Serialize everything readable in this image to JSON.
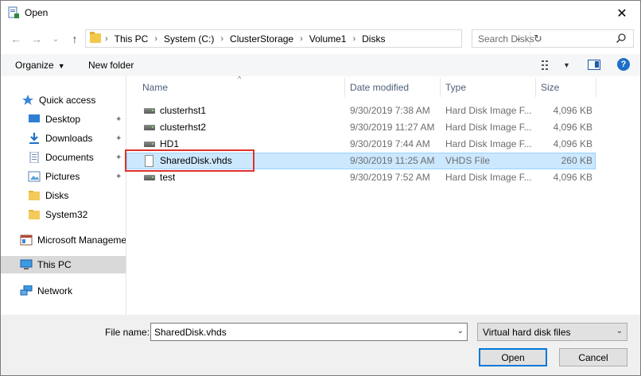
{
  "window": {
    "title": "Open",
    "close_glyph": "✕"
  },
  "nav": {
    "back_glyph": "←",
    "forward_glyph": "→",
    "recent_glyph": "⌄",
    "up_glyph": "↑",
    "breadcrumbs": [
      "This PC",
      "System (C:)",
      "ClusterStorage",
      "Volume1",
      "Disks"
    ],
    "separator": "›",
    "refresh_glyph": "↻",
    "search_placeholder": "Search Disks"
  },
  "toolbar": {
    "organize_label": "Organize",
    "new_folder_label": "New folder",
    "help_label": "?"
  },
  "sidebar": {
    "items": [
      {
        "label": "Quick access",
        "icon": "star-icon",
        "pinned": false
      },
      {
        "label": "Desktop",
        "icon": "desktop-icon",
        "pinned": true
      },
      {
        "label": "Downloads",
        "icon": "downloads-icon",
        "pinned": true
      },
      {
        "label": "Documents",
        "icon": "documents-icon",
        "pinned": true
      },
      {
        "label": "Pictures",
        "icon": "pictures-icon",
        "pinned": true
      },
      {
        "label": "Disks",
        "icon": "folder-icon",
        "pinned": false
      },
      {
        "label": "System32",
        "icon": "folder-icon",
        "pinned": false
      },
      {
        "label": "Microsoft Manageme",
        "icon": "mmc-icon",
        "pinned": false
      },
      {
        "label": "This PC",
        "icon": "computer-icon",
        "pinned": false,
        "selected": true
      },
      {
        "label": "Network",
        "icon": "network-icon",
        "pinned": false
      }
    ],
    "pin_glyph": "📌"
  },
  "file_list": {
    "columns": [
      "Name",
      "Date modified",
      "Type",
      "Size"
    ],
    "sort_glyph": "^",
    "rows": [
      {
        "name": "clusterhst1",
        "date": "9/30/2019 7:38 AM",
        "type": "Hard Disk Image F...",
        "size": "4,096 KB",
        "icon": "disk-image-icon"
      },
      {
        "name": "clusterhst2",
        "date": "9/30/2019 11:27 AM",
        "type": "Hard Disk Image F...",
        "size": "4,096 KB",
        "icon": "disk-image-icon"
      },
      {
        "name": "HD1",
        "date": "9/30/2019 7:44 AM",
        "type": "Hard Disk Image F...",
        "size": "4,096 KB",
        "icon": "disk-image-icon"
      },
      {
        "name": "SharedDisk.vhds",
        "date": "9/30/2019 11:25 AM",
        "type": "VHDS File",
        "size": "260 KB",
        "icon": "file-icon",
        "selected": true
      },
      {
        "name": "test",
        "date": "9/30/2019 7:52 AM",
        "type": "Hard Disk Image F...",
        "size": "4,096 KB",
        "icon": "disk-image-icon"
      }
    ]
  },
  "footer": {
    "file_name_label": "File name:",
    "file_name_value": "SharedDisk.vhds",
    "file_type_value": "Virtual hard disk files",
    "open_label": "Open",
    "cancel_label": "Cancel",
    "dropdown_glyph": "⌄"
  },
  "colors": {
    "selection_bg": "#cce8ff",
    "highlight_box": "#e0302c",
    "accent": "#0078d7"
  }
}
